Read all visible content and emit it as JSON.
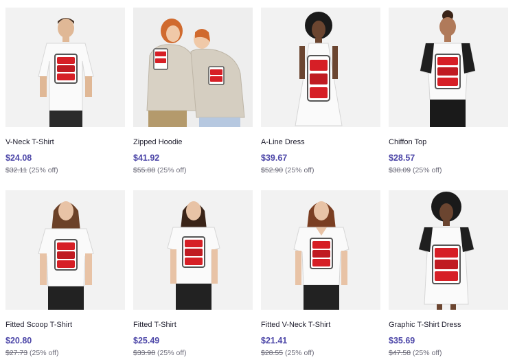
{
  "products": [
    {
      "title": "V-Neck T-Shirt",
      "price": "$24.08",
      "original_price": "$32.11",
      "discount": "(25% off)",
      "model_icon": "male-model-tshirt-icon"
    },
    {
      "title": "Zipped Hoodie",
      "price": "$41.92",
      "original_price": "$55.88",
      "discount": "(25% off)",
      "model_icon": "couple-models-hoodie-icon"
    },
    {
      "title": "A-Line Dress",
      "price": "$39.67",
      "original_price": "$52.90",
      "discount": "(25% off)",
      "model_icon": "female-model-dress-icon"
    },
    {
      "title": "Chiffon Top",
      "price": "$28.57",
      "original_price": "$38.09",
      "discount": "(25% off)",
      "model_icon": "female-model-top-icon"
    },
    {
      "title": "Fitted Scoop T-Shirt",
      "price": "$20.80",
      "original_price": "$27.73",
      "discount": "(25% off)",
      "model_icon": "female-model-tshirt-icon"
    },
    {
      "title": "Fitted T-Shirt",
      "price": "$25.49",
      "original_price": "$33.98",
      "discount": "(25% off)",
      "model_icon": "female-model-tshirt-icon"
    },
    {
      "title": "Fitted V-Neck T-Shirt",
      "price": "$21.41",
      "original_price": "$28.55",
      "discount": "(25% off)",
      "model_icon": "female-model-tshirt-icon"
    },
    {
      "title": "Graphic T-Shirt Dress",
      "price": "$35.69",
      "original_price": "$47.58",
      "discount": "(25% off)",
      "model_icon": "female-model-dress-icon"
    }
  ],
  "colors": {
    "price": "#4d47a8",
    "thumb_background": "#f2f2f2",
    "print_red": "#d61f26"
  }
}
